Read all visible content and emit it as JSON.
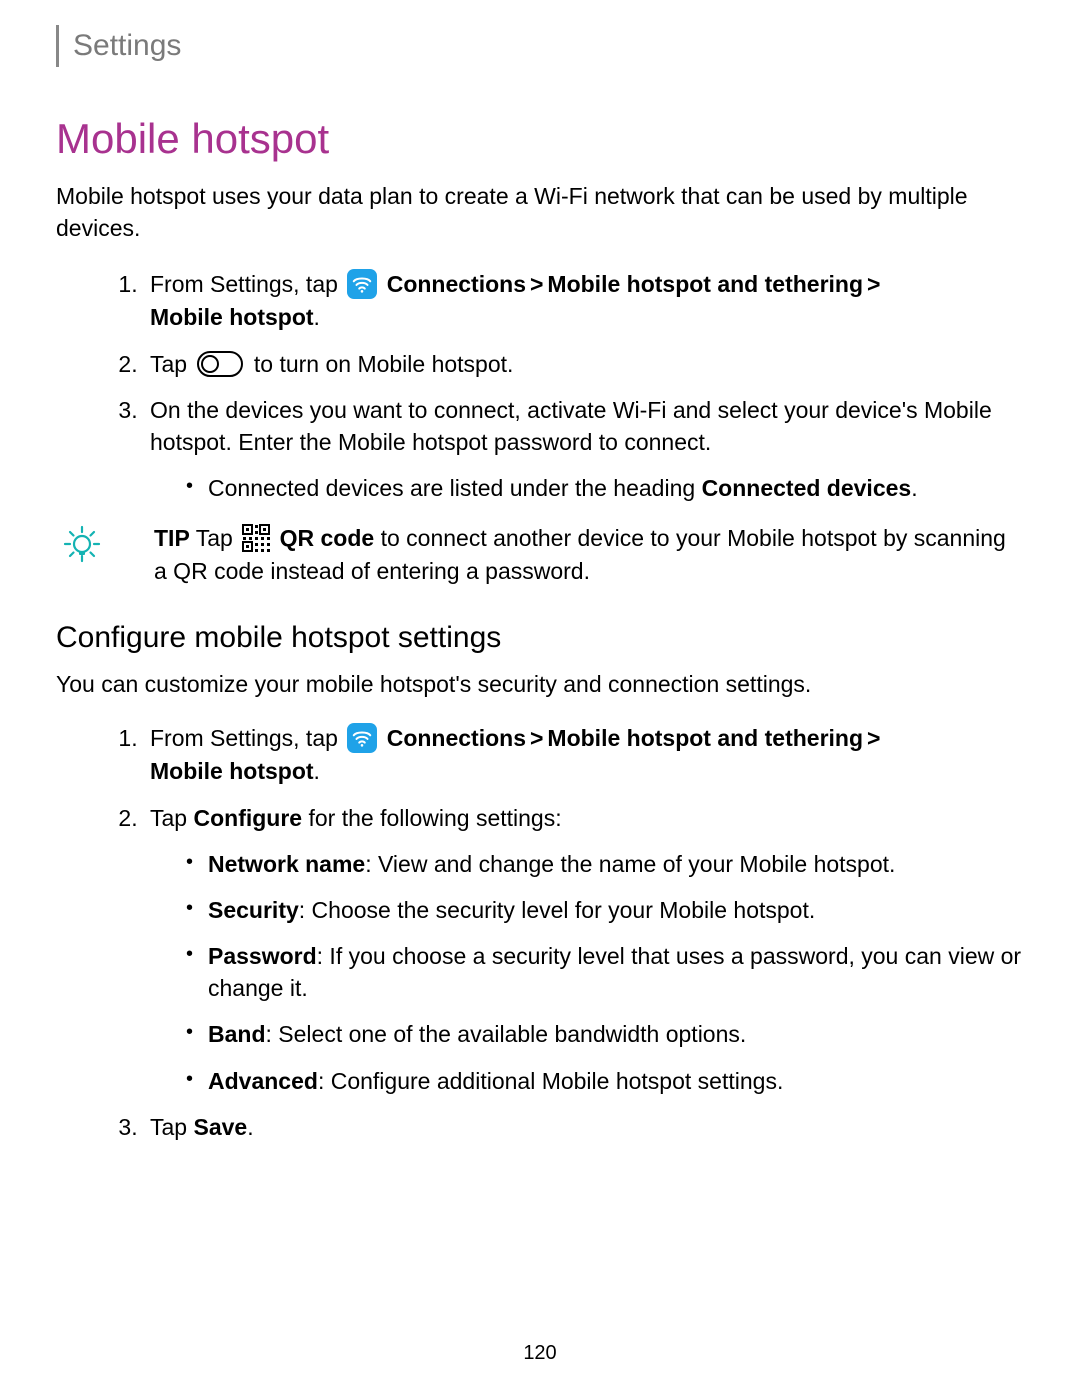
{
  "breadcrumb": "Settings",
  "h1": "Mobile hotspot",
  "intro": "Mobile hotspot uses your data plan to create a Wi-Fi network that can be used by multiple devices.",
  "sec1": {
    "step1_pre": "From Settings, tap ",
    "step1_connections": "Connections",
    "step1_mhtether": "Mobile hotspot and tethering",
    "step1_mh": "Mobile hotspot",
    "step2_pre": "Tap ",
    "step2_post": " to turn on Mobile hotspot.",
    "step3": "On the devices you want to connect, activate Wi-Fi and select your device's Mobile hotspot. Enter the Mobile hotspot password to connect.",
    "step3_bullet_pre": "Connected devices are listed under the heading ",
    "step3_bullet_bold": "Connected devices",
    "step3_bullet_post": "."
  },
  "tip": {
    "label": "TIP",
    "pre": " Tap ",
    "qr_bold": "QR code",
    "post": " to connect another device to your Mobile hotspot by scanning a QR code instead of entering a password."
  },
  "h2": "Configure mobile hotspot settings",
  "sec2_intro": "You can customize your mobile hotspot's security and connection settings.",
  "sec2": {
    "step1_pre": "From Settings, tap ",
    "step1_connections": "Connections",
    "step1_mhtether": "Mobile hotspot and tethering",
    "step1_mh": "Mobile hotspot",
    "step2_pre": "Tap ",
    "step2_configure": "Configure",
    "step2_post": " for the following settings:",
    "bullet1_bold": "Network name",
    "bullet1_rest": ": View and change the name of your Mobile hotspot.",
    "bullet2_bold": "Security",
    "bullet2_rest": ": Choose the security level for your Mobile hotspot.",
    "bullet3_bold": "Password",
    "bullet3_rest": ": If you choose a security level that uses a password, you can view or change it.",
    "bullet4_bold": "Band",
    "bullet4_rest": ": Select one of the available bandwidth options.",
    "bullet5_bold": "Advanced",
    "bullet5_rest": ": Configure additional Mobile hotspot settings.",
    "step3_pre": "Tap ",
    "step3_bold": "Save",
    "step3_post": "."
  },
  "gt": ">",
  "page_number": "120"
}
